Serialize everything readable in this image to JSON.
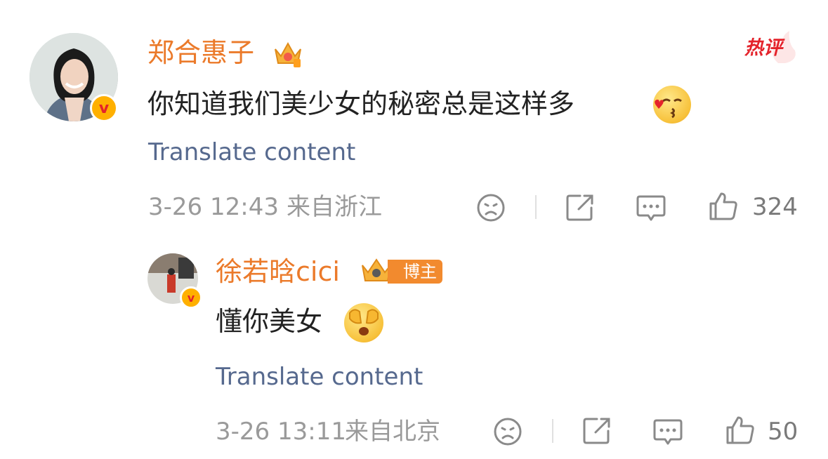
{
  "hot_badge": "热评",
  "comment": {
    "author": "郑合惠子",
    "text": "你知道我们美少女的秘密总是这样多",
    "translate": "Translate content",
    "date": "3-26 12:43",
    "location": "来自浙江",
    "likes": "324",
    "icons": [
      "unhappy-icon",
      "share-icon",
      "comment-icon",
      "like-icon"
    ]
  },
  "reply": {
    "author": "徐若晗cici",
    "author_tag": "博主",
    "text": "懂你美女",
    "translate": "Translate content",
    "date": "3-26 13:11",
    "location": "来自北京",
    "likes": "50",
    "icons": [
      "unhappy-icon",
      "share-icon",
      "comment-icon",
      "like-icon"
    ]
  },
  "colors": {
    "name": "#eb7a2a",
    "translate": "#56698e",
    "meta": "#9a9a9a",
    "hot": "#e4232b",
    "verified": "#ffb000"
  }
}
